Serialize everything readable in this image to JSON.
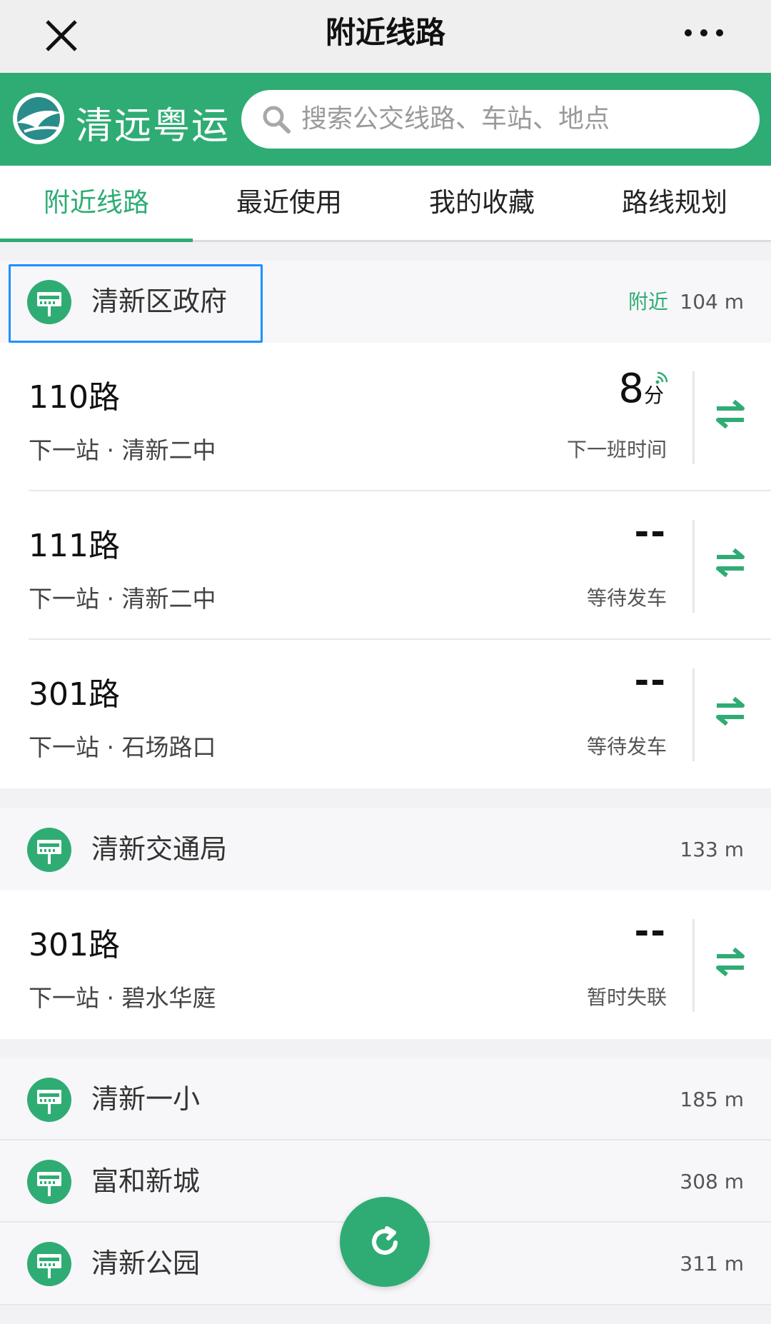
{
  "navbar": {
    "title": "附近线路"
  },
  "brand": {
    "logo_text": "清远粤运"
  },
  "search": {
    "placeholder": "搜索公交线路、车站、地点"
  },
  "tabs": [
    {
      "label": "附近线路",
      "active": true
    },
    {
      "label": "最近使用",
      "active": false
    },
    {
      "label": "我的收藏",
      "active": false
    },
    {
      "label": "路线规划",
      "active": false
    }
  ],
  "stops": [
    {
      "name": "清新区政府",
      "nearby_label": "附近",
      "distance": "104 m",
      "routes": [
        {
          "name": "110路",
          "next_stop": "下一站 · 清新二中",
          "eta_value": "8",
          "eta_unit": "分",
          "status": "下一班时间"
        },
        {
          "name": "111路",
          "next_stop": "下一站 · 清新二中",
          "eta_value": "--",
          "status": "等待发车"
        },
        {
          "name": "301路",
          "next_stop": "下一站 · 石场路口",
          "eta_value": "--",
          "status": "等待发车"
        }
      ]
    },
    {
      "name": "清新交通局",
      "distance": "133 m",
      "routes": [
        {
          "name": "301路",
          "next_stop": "下一站 · 碧水华庭",
          "eta_value": "--",
          "status": "暂时失联"
        }
      ]
    },
    {
      "name": "清新一小",
      "distance": "185 m",
      "routes": []
    },
    {
      "name": "富和新城",
      "distance": "308 m",
      "routes": []
    },
    {
      "name": "清新公园",
      "distance": "311 m",
      "routes": []
    }
  ],
  "icons": {
    "close": "close-icon",
    "more": "more-icon",
    "search": "search-icon",
    "bus_stop": "bus-stop-icon",
    "swap": "swap-direction-icon",
    "refresh": "refresh-icon",
    "realtime_signal": "signal-icon"
  },
  "colors": {
    "brand_green": "#2fac74",
    "highlight_blue": "#1e90ff"
  }
}
